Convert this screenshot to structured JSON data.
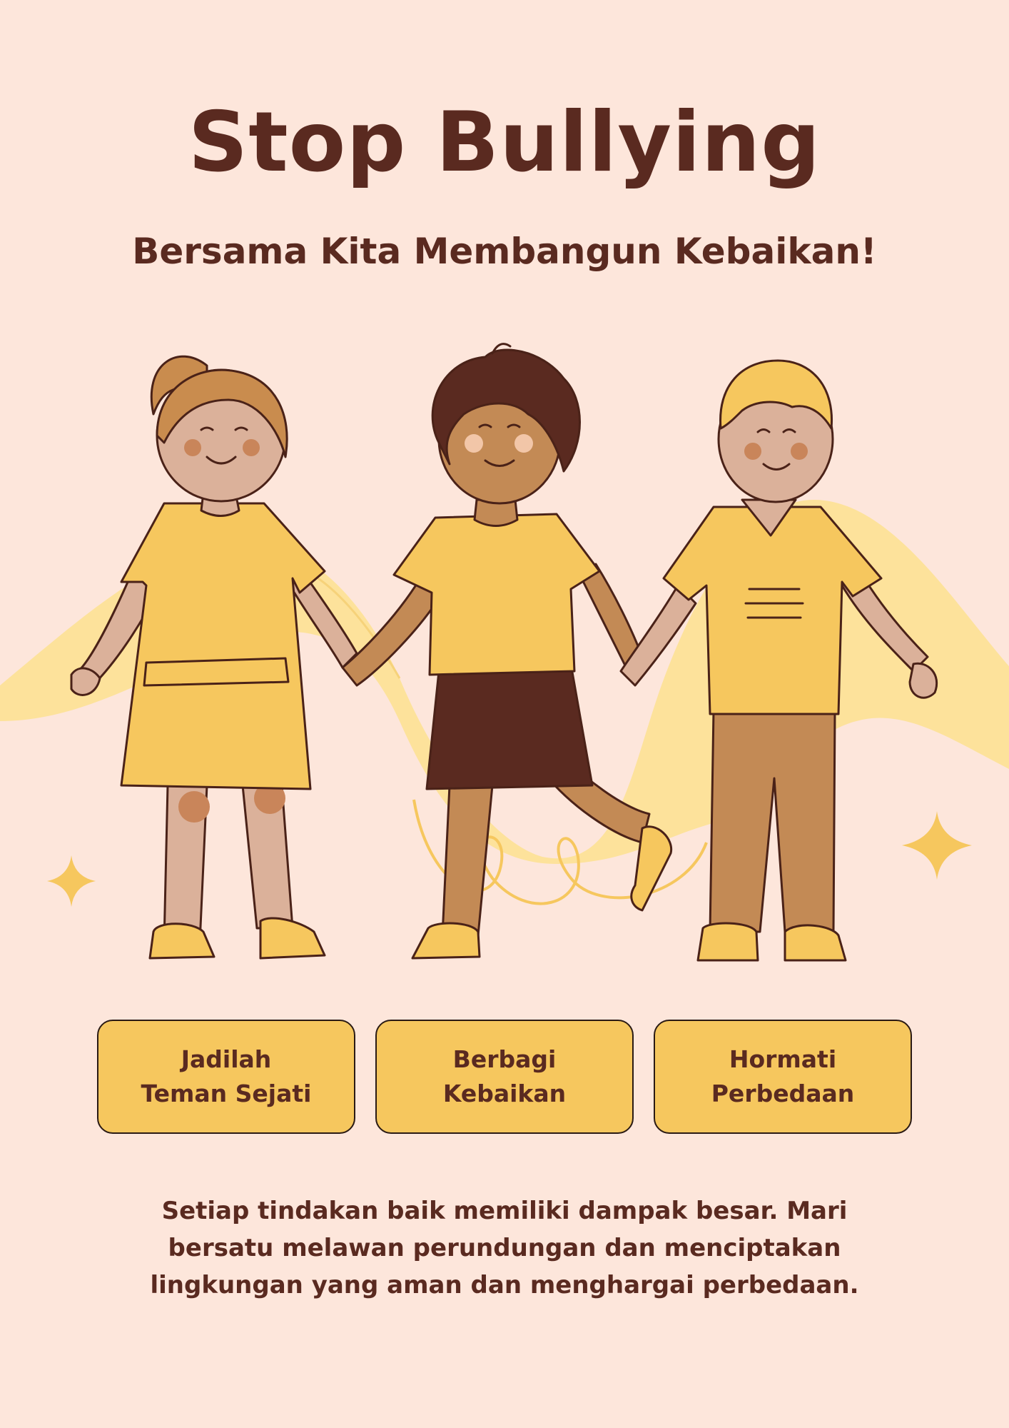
{
  "poster": {
    "title": "Stop Bullying",
    "subtitle": "Bersama Kita Membangun Kebaikan!",
    "values": [
      {
        "label": "Jadilah\nTeman Sejati"
      },
      {
        "label": "Berbagi\nKebaikan"
      },
      {
        "label": "Hormati\nPerbedaan"
      }
    ],
    "message": "Setiap tindakan baik memiliki dampak besar. Mari bersatu melawan perundungan dan menciptakan lingkungan yang aman dan menghargai perbedaan."
  },
  "colors": {
    "background": "#fde6db",
    "text": "#5a2a20",
    "accent_yellow": "#f6c75e",
    "soft_yellow": "#fde29b"
  }
}
